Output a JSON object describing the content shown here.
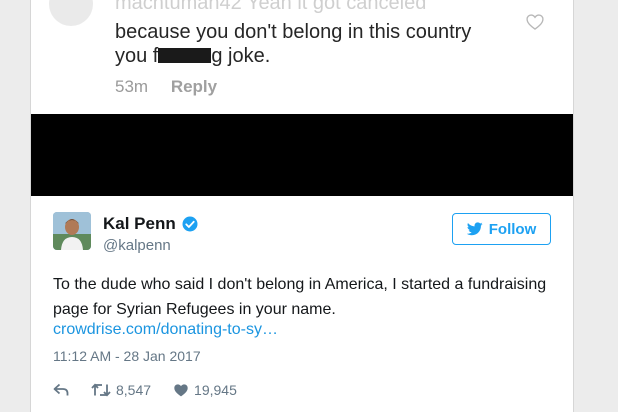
{
  "instagram_comment": {
    "faded_text": "machtuman42 Yeah it got canceled",
    "line1": "because you don't belong in this country",
    "line2_prefix": "you f",
    "line2_suffix": "g joke.",
    "time": "53m",
    "reply_label": "Reply",
    "icon": "heart-outline-icon"
  },
  "tweet": {
    "name": "Kal Penn",
    "handle": "@kalpenn",
    "follow_label": "Follow",
    "text": "To the dude who said I don't belong in America, I started a fundraising page for Syrian Refugees in your name.",
    "link": "crowdrise.com/donating-to-sy…",
    "timestamp": "11:12 AM - 28 Jan 2017",
    "retweets": "8,547",
    "likes": "19,945",
    "accent_color": "#1da1f2"
  }
}
